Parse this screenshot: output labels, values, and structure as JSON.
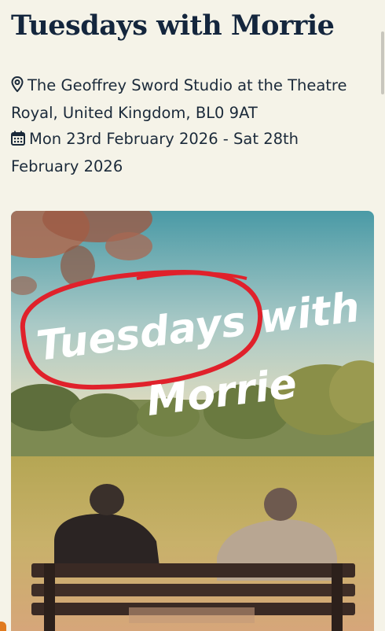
{
  "event": {
    "title": "Tuesdays with Morrie",
    "location": "The Geoffrey Sword Studio at the Theatre Royal, United Kingdom, BL0 9AT",
    "dates": "Mon 23rd February 2026 - Sat 28th February 2026"
  },
  "poster": {
    "title_line1": "Tuesdays with",
    "title_line2": "Morrie"
  },
  "icons": {
    "location": "map-pin-icon",
    "dates": "calendar-icon"
  },
  "colors": {
    "background": "#f5f3e8",
    "title": "#14263d",
    "accent": "#e07a1f",
    "poster_circle": "#e0212b"
  }
}
